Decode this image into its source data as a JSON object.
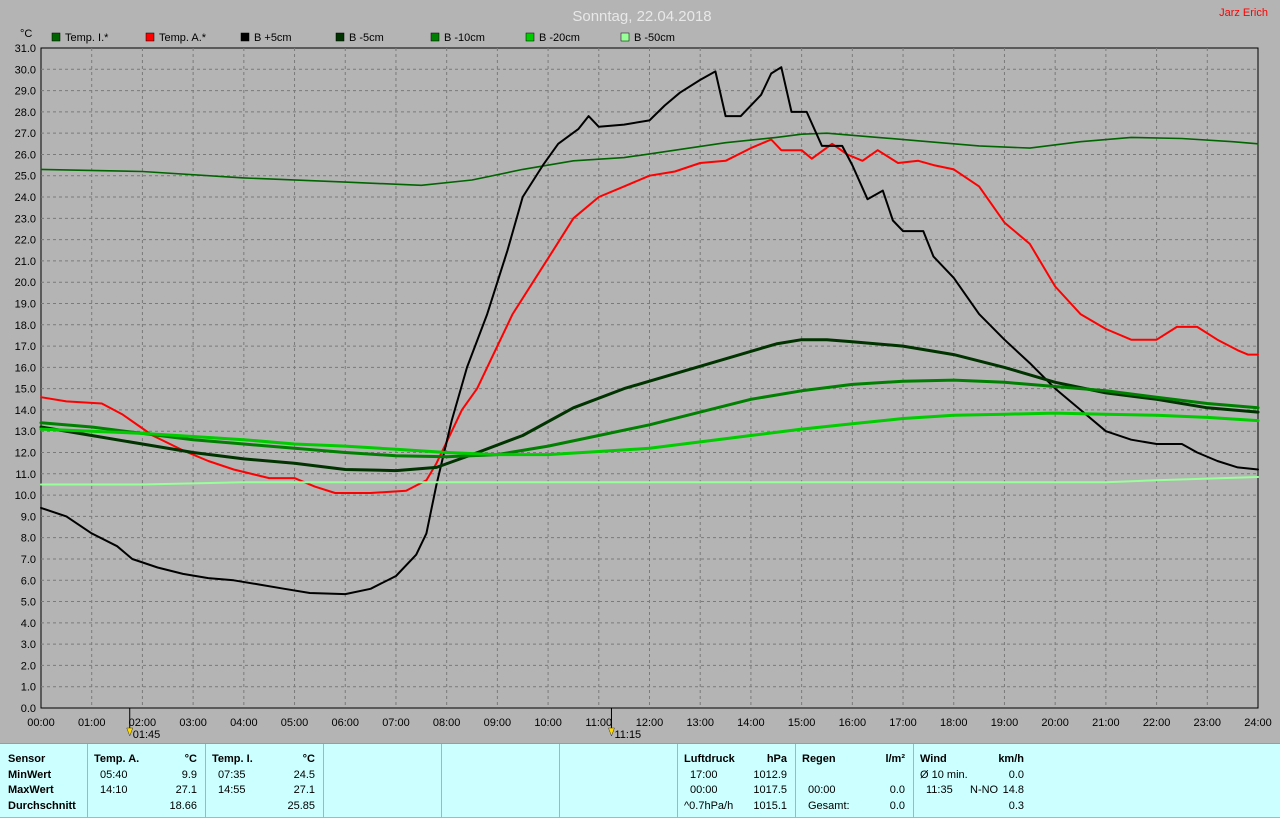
{
  "title": "Sonntag, 22.04.2018",
  "author": "Jarz Erich",
  "chart_data": {
    "type": "line",
    "ylabel": "°C",
    "ylim": [
      0,
      31
    ],
    "yticks": [
      "0.0",
      "1.0",
      "2.0",
      "3.0",
      "4.0",
      "5.0",
      "6.0",
      "7.0",
      "8.0",
      "9.0",
      "10.0",
      "11.0",
      "12.0",
      "13.0",
      "14.0",
      "15.0",
      "16.0",
      "17.0",
      "18.0",
      "19.0",
      "20.0",
      "21.0",
      "22.0",
      "23.0",
      "24.0",
      "25.0",
      "26.0",
      "27.0",
      "28.0",
      "29.0",
      "30.0",
      "31.0"
    ],
    "xlim": [
      0,
      24
    ],
    "xticks": [
      "00:00",
      "01:00",
      "02:00",
      "03:00",
      "04:00",
      "05:00",
      "06:00",
      "07:00",
      "08:00",
      "09:00",
      "10:00",
      "11:00",
      "12:00",
      "13:00",
      "14:00",
      "15:00",
      "16:00",
      "17:00",
      "18:00",
      "19:00",
      "20:00",
      "21:00",
      "22:00",
      "23:00",
      "24:00"
    ],
    "grid": true,
    "legend_position": "top",
    "markers": [
      {
        "label": "01:45",
        "x": 1.75
      },
      {
        "label": "11:15",
        "x": 11.25
      }
    ],
    "series": [
      {
        "name": "Temp. I.*",
        "color": "#006400",
        "width": 1.6,
        "points": [
          [
            0,
            25.3
          ],
          [
            2,
            25.2
          ],
          [
            4,
            24.9
          ],
          [
            6,
            24.7
          ],
          [
            7.5,
            24.55
          ],
          [
            8.5,
            24.8
          ],
          [
            9.5,
            25.3
          ],
          [
            10.5,
            25.7
          ],
          [
            11.5,
            25.85
          ],
          [
            12.5,
            26.2
          ],
          [
            13.5,
            26.55
          ],
          [
            14.5,
            26.8
          ],
          [
            15,
            26.95
          ],
          [
            15.5,
            27.0
          ],
          [
            16.5,
            26.8
          ],
          [
            17.5,
            26.6
          ],
          [
            18.5,
            26.4
          ],
          [
            19.5,
            26.3
          ],
          [
            20.5,
            26.6
          ],
          [
            21.5,
            26.8
          ],
          [
            22.5,
            26.75
          ],
          [
            23.5,
            26.6
          ],
          [
            24,
            26.5
          ]
        ]
      },
      {
        "name": "Temp. A.*",
        "color": "#ff0000",
        "width": 2,
        "points": [
          [
            0,
            14.6
          ],
          [
            0.5,
            14.4
          ],
          [
            1.2,
            14.3
          ],
          [
            1.6,
            13.8
          ],
          [
            2.2,
            12.8
          ],
          [
            2.8,
            12.1
          ],
          [
            3.3,
            11.6
          ],
          [
            3.8,
            11.2
          ],
          [
            4.5,
            10.8
          ],
          [
            5,
            10.8
          ],
          [
            5.4,
            10.4
          ],
          [
            5.8,
            10.1
          ],
          [
            6.5,
            10.1
          ],
          [
            7.2,
            10.2
          ],
          [
            7.6,
            10.7
          ],
          [
            7.8,
            11.5
          ],
          [
            8,
            12.5
          ],
          [
            8.3,
            14
          ],
          [
            8.6,
            15
          ],
          [
            8.9,
            16.5
          ],
          [
            9.3,
            18.5
          ],
          [
            9.7,
            20
          ],
          [
            10.1,
            21.5
          ],
          [
            10.5,
            23
          ],
          [
            11,
            24
          ],
          [
            11.5,
            24.5
          ],
          [
            12,
            25
          ],
          [
            12.5,
            25.2
          ],
          [
            13,
            25.6
          ],
          [
            13.5,
            25.7
          ],
          [
            14,
            26.3
          ],
          [
            14.4,
            26.7
          ],
          [
            14.6,
            26.2
          ],
          [
            15,
            26.2
          ],
          [
            15.2,
            25.8
          ],
          [
            15.6,
            26.5
          ],
          [
            15.9,
            26.0
          ],
          [
            16.2,
            25.7
          ],
          [
            16.5,
            26.2
          ],
          [
            16.9,
            25.6
          ],
          [
            17.3,
            25.7
          ],
          [
            17.6,
            25.5
          ],
          [
            18,
            25.3
          ],
          [
            18.5,
            24.5
          ],
          [
            19,
            22.8
          ],
          [
            19.5,
            21.8
          ],
          [
            20,
            19.8
          ],
          [
            20.5,
            18.5
          ],
          [
            21,
            17.8
          ],
          [
            21.5,
            17.3
          ],
          [
            22,
            17.3
          ],
          [
            22.4,
            17.9
          ],
          [
            22.8,
            17.9
          ],
          [
            23.2,
            17.3
          ],
          [
            23.6,
            16.8
          ],
          [
            23.8,
            16.6
          ],
          [
            24,
            16.6
          ]
        ]
      },
      {
        "name": "B +5cm",
        "color": "#000000",
        "width": 2,
        "points": [
          [
            0,
            9.4
          ],
          [
            0.5,
            9.0
          ],
          [
            1,
            8.2
          ],
          [
            1.5,
            7.6
          ],
          [
            1.8,
            7.0
          ],
          [
            2.3,
            6.6
          ],
          [
            2.8,
            6.3
          ],
          [
            3.3,
            6.1
          ],
          [
            3.8,
            6.0
          ],
          [
            4.3,
            5.8
          ],
          [
            4.8,
            5.6
          ],
          [
            5.3,
            5.4
          ],
          [
            6,
            5.35
          ],
          [
            6.5,
            5.6
          ],
          [
            7,
            6.2
          ],
          [
            7.4,
            7.2
          ],
          [
            7.6,
            8.2
          ],
          [
            7.8,
            10.5
          ],
          [
            8.1,
            13.5
          ],
          [
            8.4,
            16
          ],
          [
            8.8,
            18.5
          ],
          [
            9.2,
            21.5
          ],
          [
            9.5,
            24
          ],
          [
            9.9,
            25.5
          ],
          [
            10.2,
            26.5
          ],
          [
            10.6,
            27.2
          ],
          [
            10.8,
            27.8
          ],
          [
            11,
            27.3
          ],
          [
            11.5,
            27.4
          ],
          [
            12,
            27.6
          ],
          [
            12.3,
            28.3
          ],
          [
            12.6,
            28.9
          ],
          [
            13,
            29.5
          ],
          [
            13.3,
            29.9
          ],
          [
            13.5,
            27.8
          ],
          [
            13.8,
            27.8
          ],
          [
            14.2,
            28.8
          ],
          [
            14.4,
            29.8
          ],
          [
            14.6,
            30.1
          ],
          [
            14.8,
            28.0
          ],
          [
            15.1,
            28.0
          ],
          [
            15.4,
            26.4
          ],
          [
            15.8,
            26.4
          ],
          [
            16,
            25.5
          ],
          [
            16.3,
            23.9
          ],
          [
            16.6,
            24.3
          ],
          [
            16.8,
            22.9
          ],
          [
            17,
            22.4
          ],
          [
            17.4,
            22.4
          ],
          [
            17.6,
            21.2
          ],
          [
            18,
            20.2
          ],
          [
            18.5,
            18.5
          ],
          [
            19,
            17.3
          ],
          [
            19.5,
            16.2
          ],
          [
            20,
            15.0
          ],
          [
            20.5,
            14.0
          ],
          [
            21,
            13.0
          ],
          [
            21.5,
            12.6
          ],
          [
            22,
            12.4
          ],
          [
            22.5,
            12.4
          ],
          [
            22.8,
            12.0
          ],
          [
            23.2,
            11.6
          ],
          [
            23.6,
            11.3
          ],
          [
            24,
            11.2
          ]
        ]
      },
      {
        "name": "B -5cm",
        "color": "#003300",
        "width": 3,
        "points": [
          [
            0,
            13.2
          ],
          [
            1,
            12.8
          ],
          [
            2,
            12.4
          ],
          [
            3,
            12.0
          ],
          [
            4,
            11.7
          ],
          [
            5,
            11.5
          ],
          [
            6,
            11.2
          ],
          [
            7,
            11.15
          ],
          [
            7.8,
            11.3
          ],
          [
            8.5,
            11.9
          ],
          [
            9.5,
            12.8
          ],
          [
            10.5,
            14.1
          ],
          [
            11.5,
            15.0
          ],
          [
            12.5,
            15.7
          ],
          [
            13.5,
            16.4
          ],
          [
            14.5,
            17.1
          ],
          [
            15,
            17.3
          ],
          [
            15.5,
            17.3
          ],
          [
            16,
            17.2
          ],
          [
            17,
            17.0
          ],
          [
            18,
            16.6
          ],
          [
            19,
            16.0
          ],
          [
            20,
            15.3
          ],
          [
            21,
            14.8
          ],
          [
            22,
            14.5
          ],
          [
            23,
            14.1
          ],
          [
            24,
            13.9
          ]
        ]
      },
      {
        "name": "B -10cm",
        "color": "#008000",
        "width": 3,
        "points": [
          [
            0,
            13.4
          ],
          [
            1,
            13.2
          ],
          [
            2,
            12.9
          ],
          [
            3,
            12.6
          ],
          [
            4,
            12.4
          ],
          [
            5,
            12.2
          ],
          [
            6,
            12.0
          ],
          [
            7,
            11.85
          ],
          [
            8,
            11.8
          ],
          [
            9,
            11.9
          ],
          [
            10,
            12.3
          ],
          [
            11,
            12.8
          ],
          [
            12,
            13.3
          ],
          [
            13,
            13.9
          ],
          [
            14,
            14.5
          ],
          [
            15,
            14.9
          ],
          [
            16,
            15.2
          ],
          [
            17,
            15.35
          ],
          [
            18,
            15.4
          ],
          [
            19,
            15.3
          ],
          [
            20,
            15.1
          ],
          [
            21,
            14.9
          ],
          [
            22,
            14.6
          ],
          [
            23,
            14.3
          ],
          [
            24,
            14.1
          ]
        ]
      },
      {
        "name": "B -20cm",
        "color": "#00cc00",
        "width": 3,
        "points": [
          [
            0,
            13.1
          ],
          [
            1,
            13.0
          ],
          [
            2,
            12.9
          ],
          [
            3,
            12.75
          ],
          [
            4,
            12.6
          ],
          [
            5,
            12.4
          ],
          [
            6,
            12.3
          ],
          [
            7,
            12.15
          ],
          [
            8,
            12.0
          ],
          [
            9,
            11.9
          ],
          [
            10,
            11.9
          ],
          [
            11,
            12.05
          ],
          [
            12,
            12.2
          ],
          [
            13,
            12.5
          ],
          [
            14,
            12.8
          ],
          [
            15,
            13.1
          ],
          [
            16,
            13.35
          ],
          [
            17,
            13.6
          ],
          [
            18,
            13.75
          ],
          [
            19,
            13.8
          ],
          [
            20,
            13.85
          ],
          [
            21,
            13.8
          ],
          [
            22,
            13.75
          ],
          [
            23,
            13.65
          ],
          [
            24,
            13.5
          ]
        ]
      },
      {
        "name": "B -50cm",
        "color": "#99ff99",
        "width": 2,
        "points": [
          [
            0,
            10.5
          ],
          [
            2,
            10.5
          ],
          [
            4,
            10.6
          ],
          [
            6,
            10.6
          ],
          [
            10,
            10.6
          ],
          [
            14,
            10.6
          ],
          [
            18,
            10.6
          ],
          [
            21,
            10.6
          ],
          [
            22,
            10.7
          ],
          [
            24,
            10.85
          ]
        ]
      }
    ]
  },
  "stats": {
    "sensor": {
      "header": "Sensor",
      "min": "MinWert",
      "max": "MaxWert",
      "avg": "Durchschnitt"
    },
    "temp_a": {
      "header": "Temp. A.",
      "unit": "°C",
      "min_time": "05:40",
      "min_val": "9.9",
      "max_time": "14:10",
      "max_val": "27.1",
      "avg": "18.66"
    },
    "temp_i": {
      "header": "Temp. I.",
      "unit": "°C",
      "min_time": "07:35",
      "min_val": "24.5",
      "max_time": "14:55",
      "max_val": "27.1",
      "avg": "25.85"
    },
    "pressure": {
      "header": "Luftdruck",
      "unit": "hPa",
      "r1_label": "17:00",
      "r1_val": "1012.9",
      "r2_label": "00:00",
      "r2_val": "1017.5",
      "r3_label": "^0.7hPa/h",
      "r3_val": "1015.1"
    },
    "rain": {
      "header": "Regen",
      "unit": "l/m²",
      "r2_label": "00:00",
      "r2_val": "0.0",
      "r3_label": "Gesamt:",
      "r3_val": "0.0"
    },
    "wind": {
      "header": "Wind",
      "unit": "km/h",
      "r1_label": "Ø 10 min.",
      "r1_val": "0.0",
      "r2_time": "11:35",
      "r2_dir": "N-NO",
      "r2_val": "14.8",
      "r3_val": "0.3"
    }
  }
}
